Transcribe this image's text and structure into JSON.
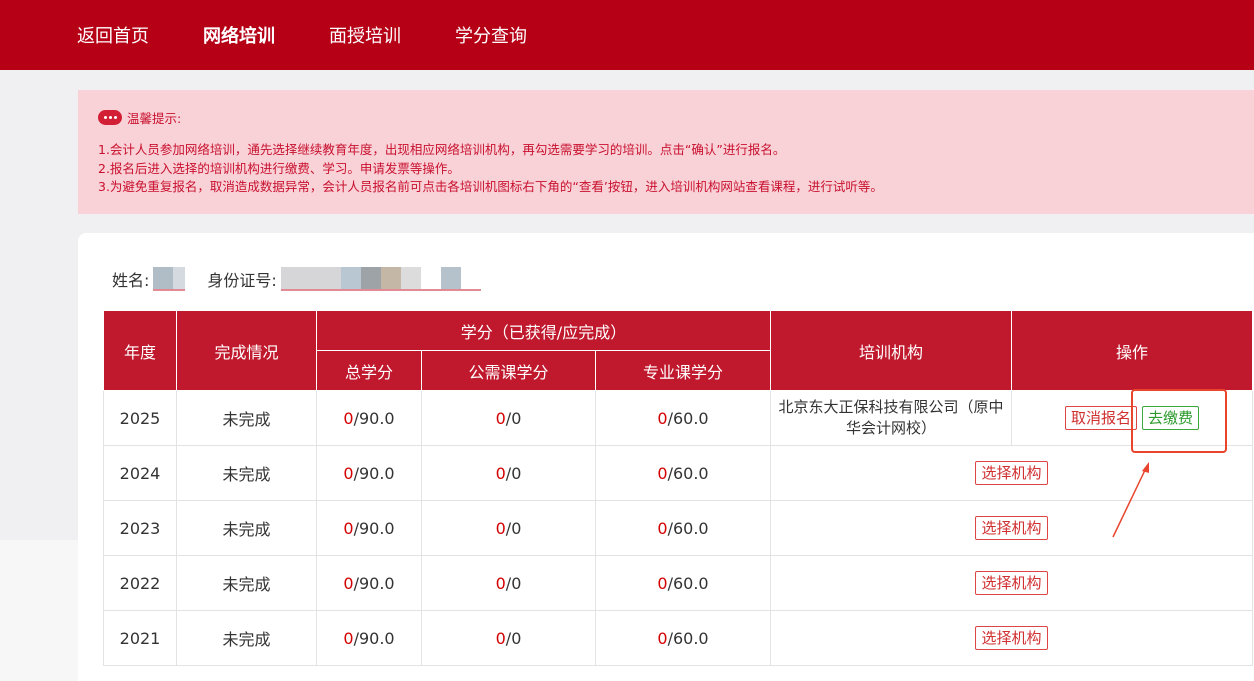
{
  "nav": {
    "items": [
      {
        "label": "返回首页",
        "active": false
      },
      {
        "label": "网络培训",
        "active": true
      },
      {
        "label": "面授培训",
        "active": false
      },
      {
        "label": "学分查询",
        "active": false
      }
    ]
  },
  "notice": {
    "title": "温馨提示:",
    "lines": [
      "1.会计人员参加网络培训，通先选择继续教育年度，出现相应网络培训机构，再勾选需要学习的培训。点击“确认”进行报名。",
      "2.报名后进入选择的培训机构进行缴费、学习。申请发票等操作。",
      "3.为避免重复报名，取消造成数据异常，会计人员报名前可点击各培训机图标右下角的“查看’按钮，进入培训机构网站查看课程，进行试听等。"
    ]
  },
  "user": {
    "name_label": "姓名:",
    "id_label": "身份证号:"
  },
  "table": {
    "headers": {
      "year": "年度",
      "status": "完成情况",
      "credits": "学分（已获得/应完成）",
      "total": "总学分",
      "public": "公需课学分",
      "professional": "专业课学分",
      "institution": "培训机构",
      "action": "操作"
    },
    "rows": [
      {
        "year": "2025",
        "status": "未完成",
        "total_got": "0",
        "total_req": "/90.0",
        "public_got": "0",
        "public_req": "/0",
        "pro_got": "0",
        "pro_req": "/60.0",
        "institution": "北京东大正保科技有限公司（原中华会计网校）",
        "cancel": "取消报名",
        "pay": "去缴费"
      },
      {
        "year": "2024",
        "status": "未完成",
        "total_got": "0",
        "total_req": "/90.0",
        "public_got": "0",
        "public_req": "/0",
        "pro_got": "0",
        "pro_req": "/60.0",
        "select": "选择机构"
      },
      {
        "year": "2023",
        "status": "未完成",
        "total_got": "0",
        "total_req": "/90.0",
        "public_got": "0",
        "public_req": "/0",
        "pro_got": "0",
        "pro_req": "/60.0",
        "select": "选择机构"
      },
      {
        "year": "2022",
        "status": "未完成",
        "total_got": "0",
        "total_req": "/90.0",
        "public_got": "0",
        "public_req": "/0",
        "pro_got": "0",
        "pro_req": "/60.0",
        "select": "选择机构"
      },
      {
        "year": "2021",
        "status": "未完成",
        "total_got": "0",
        "total_req": "/90.0",
        "public_got": "0",
        "public_req": "/0",
        "pro_got": "0",
        "pro_req": "/60.0",
        "select": "选择机构"
      }
    ]
  },
  "colors": {
    "brand": "#b50016",
    "header": "#c0182c",
    "notice_bg": "#f9d2d8",
    "annotation": "#e8452c"
  }
}
